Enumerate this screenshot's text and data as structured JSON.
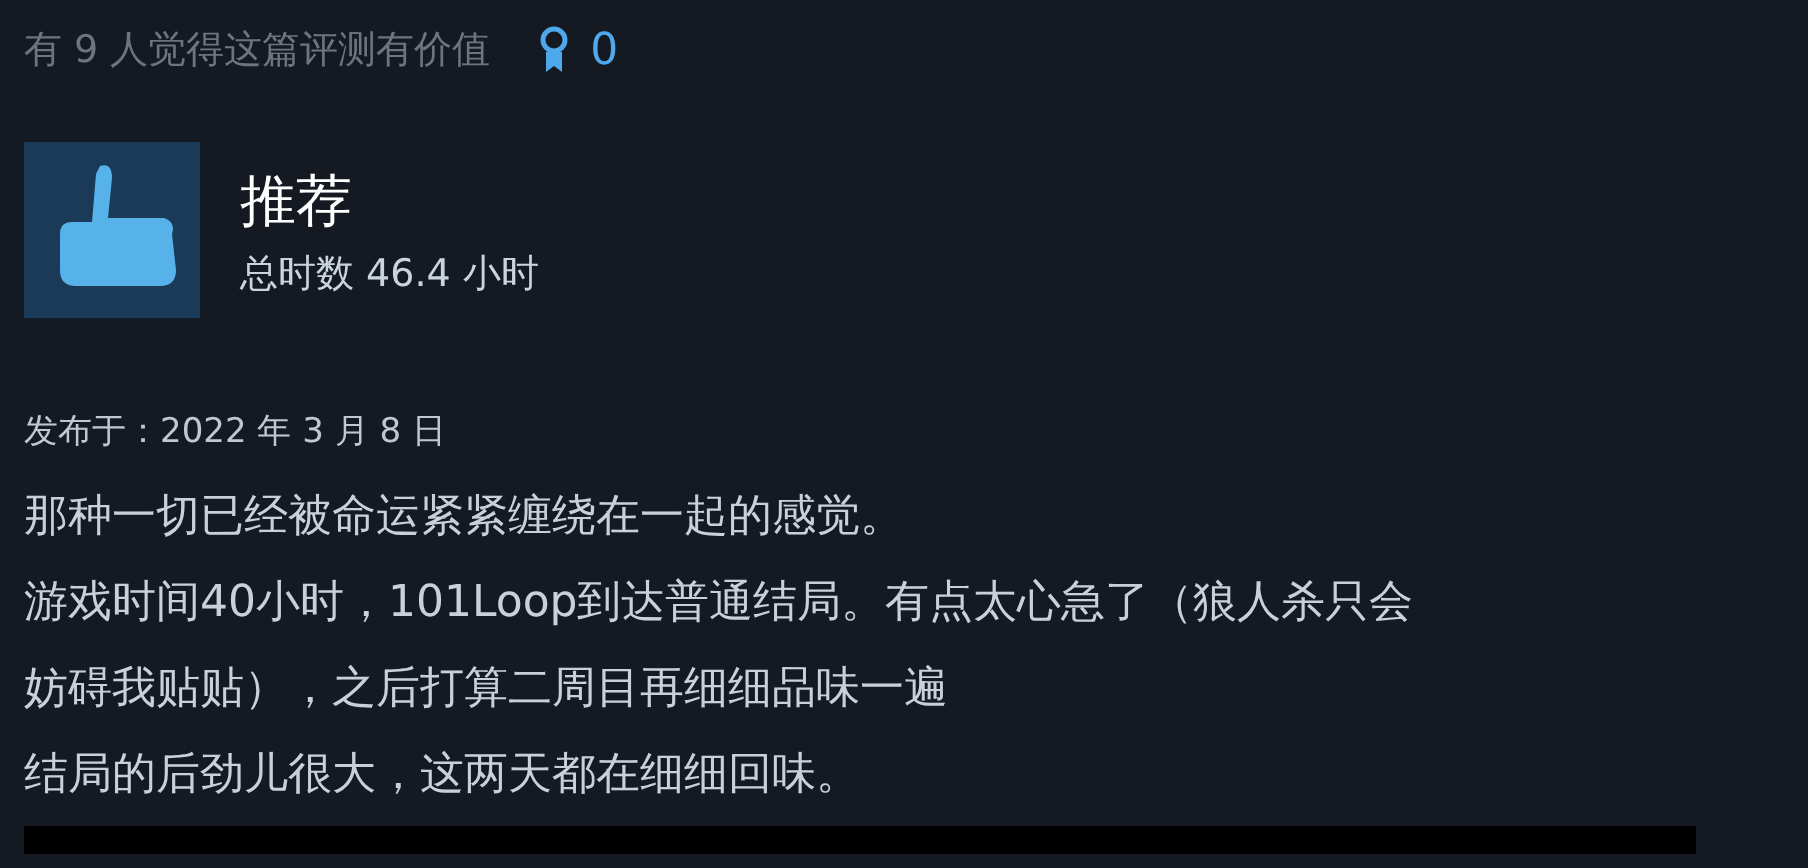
{
  "helpful": {
    "text": "有 9 人觉得这篇评测有价值",
    "awards": "0"
  },
  "verdict": {
    "kind": "recommended",
    "label": "推荐",
    "playtime": "总时数 46.4 小时"
  },
  "posted": "发布于：2022 年 3 月 8 日",
  "body_lines": [
    "那种一切已经被命运紧紧缠绕在一起的感觉。",
    "游戏时间40小时，101Loop到达普通结局。有点太心急了（狼人杀只会",
    "妨碍我贴贴），之后打算二周目再细细品味一遍",
    "结局的后劲儿很大，这两天都在细细回味。"
  ]
}
